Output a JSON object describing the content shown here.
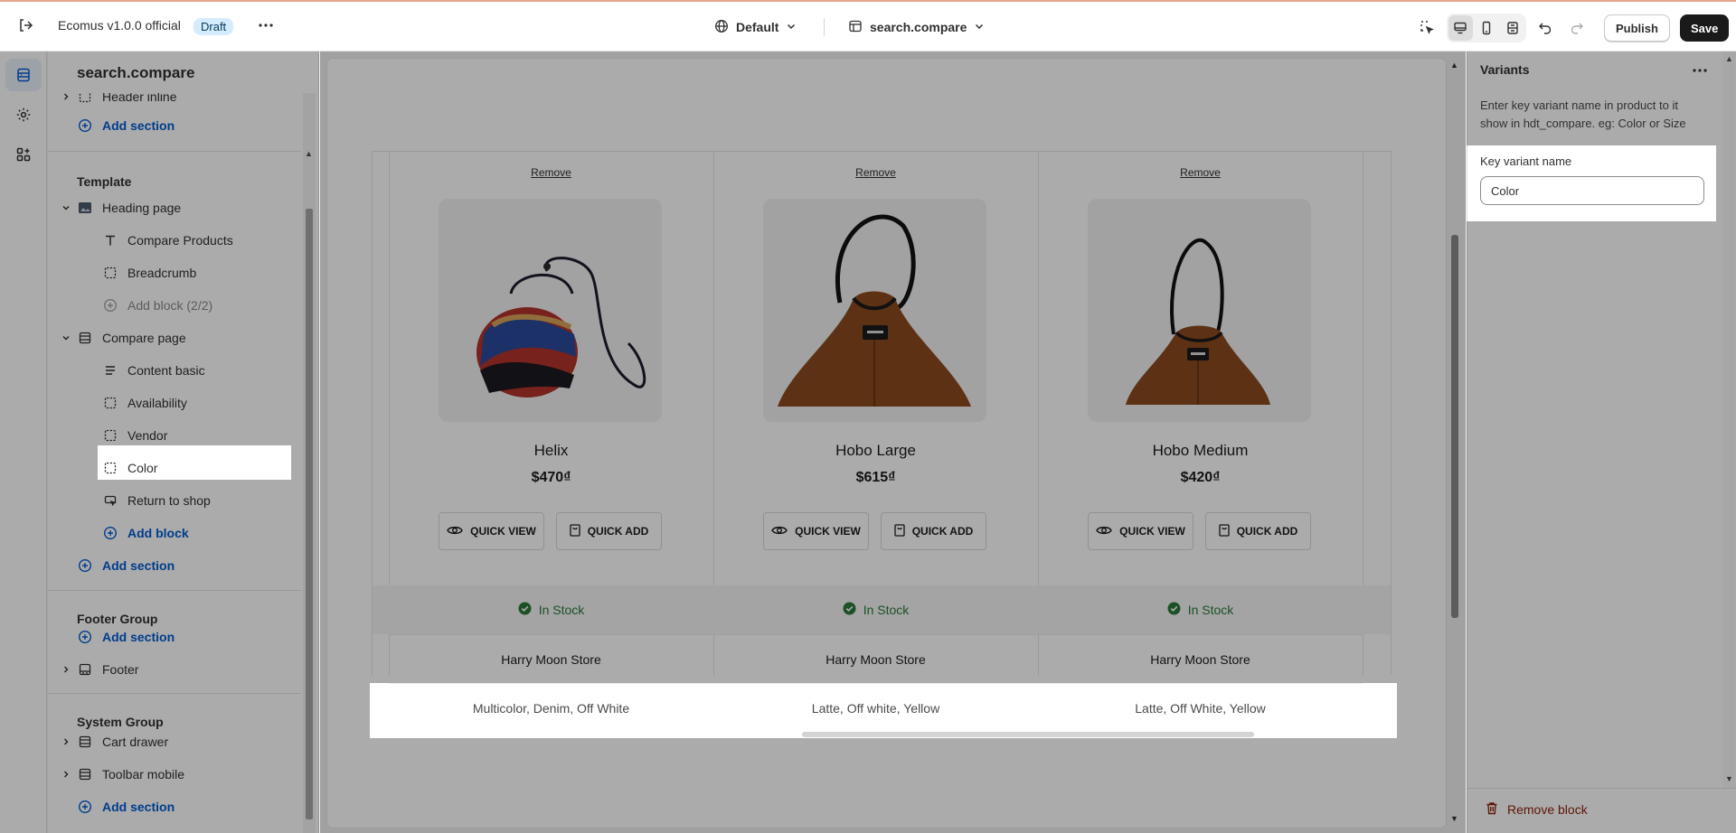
{
  "topbar": {
    "app_name": "Ecomus v1.0.0 official",
    "status_badge": "Draft",
    "theme_selector": "Default",
    "template_selector": "search.compare",
    "publish_label": "Publish",
    "save_label": "Save"
  },
  "left_panel": {
    "title": "search.compare",
    "header_inline": "Header inline",
    "add_section_1": "Add section",
    "template_group": "Template",
    "heading_page": "Heading page",
    "compare_products": "Compare Products",
    "breadcrumb": "Breadcrumb",
    "add_block_disabled": "Add block (2/2)",
    "compare_page": "Compare page",
    "content_basic": "Content basic",
    "availability": "Availability",
    "vendor": "Vendor",
    "color": "Color",
    "return_to_shop": "Return to shop",
    "add_block": "Add block",
    "add_section_2": "Add section",
    "footer_group": "Footer Group",
    "add_section_3": "Add section",
    "footer": "Footer",
    "system_group": "System Group",
    "cart_drawer": "Cart drawer",
    "toolbar_mobile": "Toolbar mobile",
    "add_section_4": "Add section"
  },
  "preview": {
    "remove_label": "Remove",
    "quick_view_label": "QUICK VIEW",
    "quick_add_label": "QUICK ADD",
    "products": [
      {
        "name": "Helix",
        "price": "$470₫",
        "stock": "In Stock",
        "vendor": "Harry Moon Store",
        "colors": "Multicolor, Denim, Off White"
      },
      {
        "name": "Hobo Large",
        "price": "$615₫",
        "stock": "In Stock",
        "vendor": "Harry Moon Store",
        "colors": "Latte, Off white, Yellow"
      },
      {
        "name": "Hobo Medium",
        "price": "$420₫",
        "stock": "In Stock",
        "vendor": "Harry Moon Store",
        "colors": "Latte, Off White, Yellow"
      }
    ]
  },
  "right_panel": {
    "title": "Variants",
    "description": "Enter key variant name in product to it show in hdt_compare. eg: Color or Size",
    "field_label": "Key variant name",
    "field_value": "Color",
    "remove_block_label": "Remove block"
  },
  "colors": {
    "accent": "#005bd3",
    "stock_green": "#2a7a3a",
    "danger": "#8e1f0b",
    "save_bg": "#1a1a1a"
  }
}
